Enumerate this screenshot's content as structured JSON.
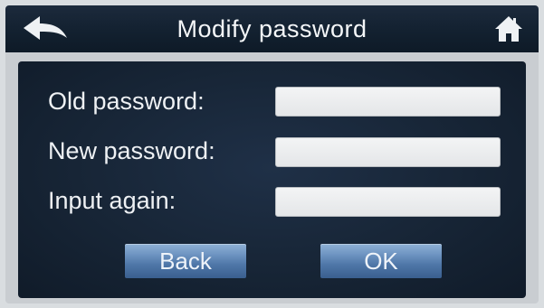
{
  "header": {
    "title": "Modify password",
    "back_icon": "back-arrow-icon",
    "home_icon": "home-icon"
  },
  "form": {
    "old_password_label": "Old password:",
    "new_password_label": "New password:",
    "input_again_label": "Input  again:",
    "old_password_value": "",
    "new_password_value": "",
    "input_again_value": ""
  },
  "buttons": {
    "back_label": "Back",
    "ok_label": "OK"
  },
  "colors": {
    "title_bar": "#12202f",
    "panel": "#172536",
    "field": "#eceef0",
    "button": "#5a82b3"
  }
}
